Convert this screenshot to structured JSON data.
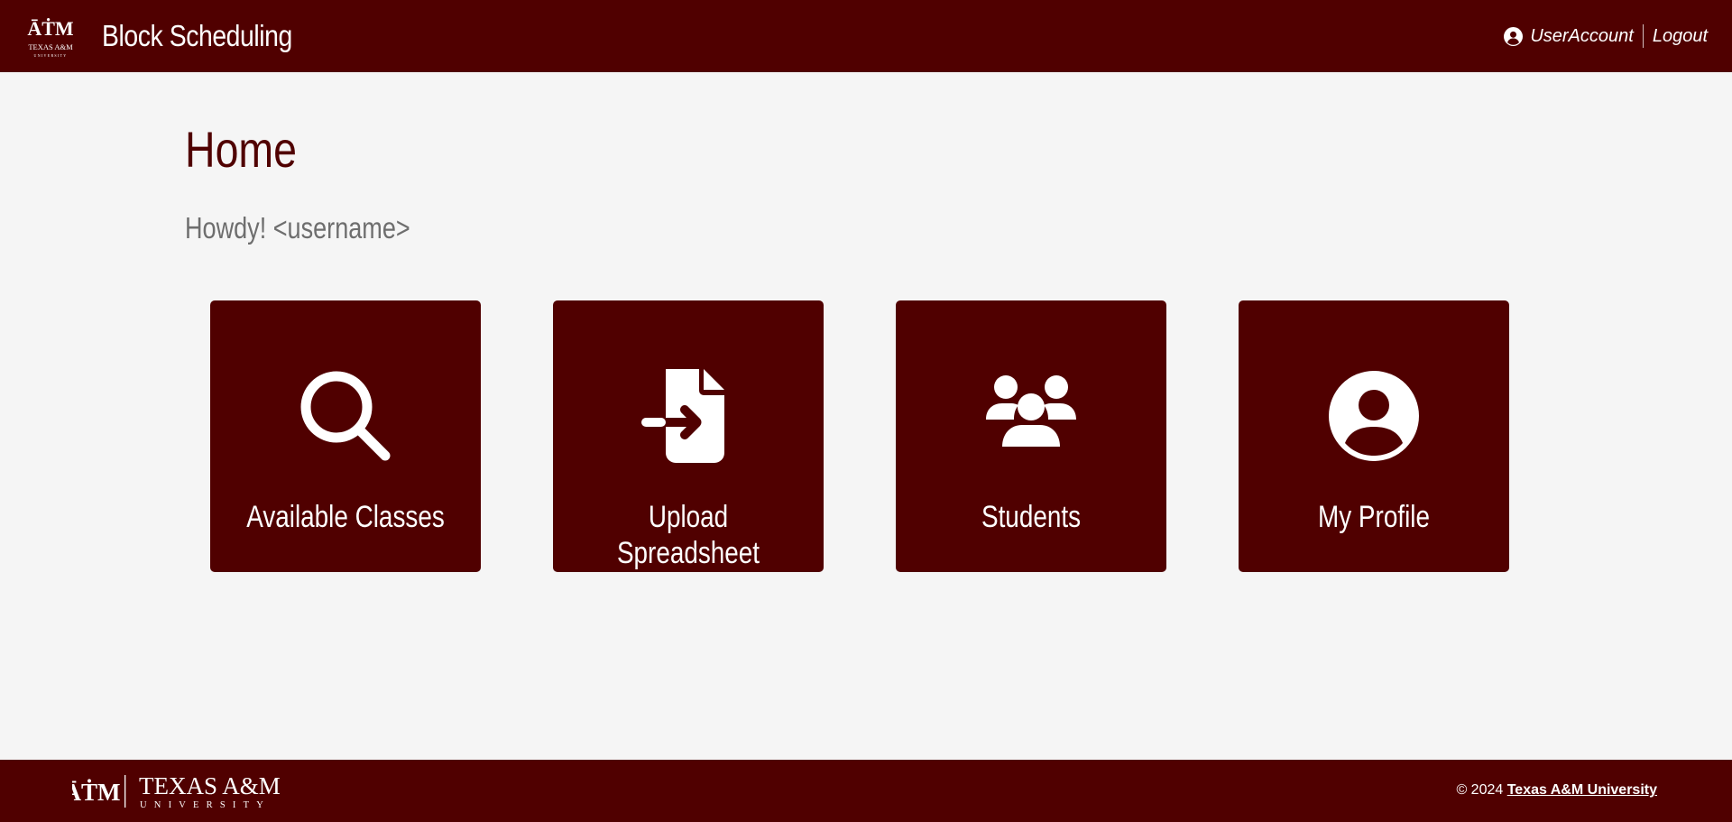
{
  "header": {
    "title": "Block Scheduling",
    "logo_alt": "Texas A&M University",
    "user_label": "UserAccount",
    "logout_label": "Logout"
  },
  "main": {
    "title": "Home",
    "greeting": "Howdy! <username>",
    "tiles": [
      {
        "label": "Available Classes",
        "icon": "search-icon"
      },
      {
        "label": "Upload Spreadsheet",
        "icon": "file-import-icon"
      },
      {
        "label": "Students",
        "icon": "users-icon"
      },
      {
        "label": "My Profile",
        "icon": "user-circle-icon"
      }
    ]
  },
  "footer": {
    "logo_text": "TEXAS A&M",
    "logo_subtext": "UNIVERSITY",
    "copyright_prefix": "© 2024",
    "copyright_link": "Texas A&M University"
  },
  "colors": {
    "brand": "#500000",
    "background": "#f5f5f5",
    "greeting": "#6e6e6e"
  }
}
